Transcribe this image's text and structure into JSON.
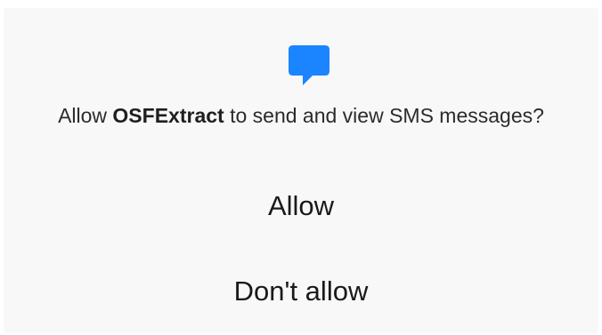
{
  "dialog": {
    "icon": "sms-bubble-icon",
    "accent_color": "#1a85ff",
    "message_prefix": "Allow ",
    "app_name": "OSFExtract",
    "message_suffix": " to send and view SMS messages?",
    "allow_label": "Allow",
    "deny_label": "Don't allow"
  }
}
